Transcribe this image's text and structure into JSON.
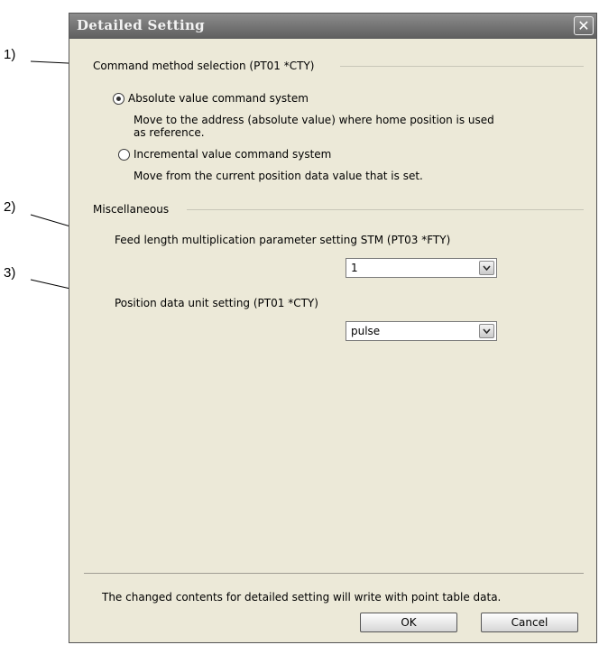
{
  "dialog": {
    "title": "Detailed Setting",
    "close_glyph": "✕"
  },
  "command_group": {
    "title": "Command method selection (PT01 *CTY)",
    "absolute": {
      "label": "Absolute value command system",
      "desc_line1": "Move to the address (absolute value) where home position is used",
      "desc_line2": "as reference.",
      "selected": true
    },
    "incremental": {
      "label": "Incremental value command system",
      "desc": "Move from the current position data value that is set.",
      "selected": false
    }
  },
  "misc_group": {
    "title": "Miscellaneous",
    "feed_label": "Feed length multiplication parameter setting STM (PT03 *FTY)",
    "feed_value": "1",
    "unit_label": "Position data unit setting (PT01 *CTY)",
    "unit_value": "pulse"
  },
  "footer": {
    "note": "The changed contents for detailed setting will write with point table data.",
    "ok_label": "OK",
    "cancel_label": "Cancel"
  },
  "callouts": [
    "1)",
    "2)",
    "3)"
  ],
  "icons": {
    "close": "close-icon",
    "dropdown": "chevron-down-icon",
    "radio": "radio-icon"
  }
}
